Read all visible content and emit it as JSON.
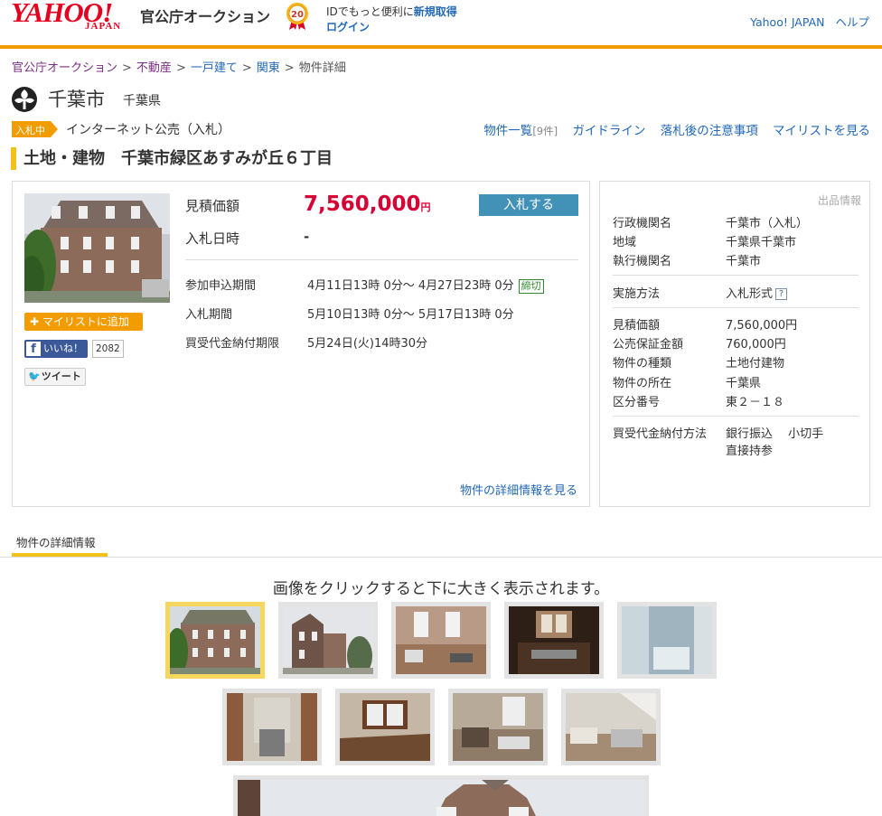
{
  "header": {
    "logo_main": "YAHOO!",
    "logo_sub": "JAPAN",
    "service_name": "官公庁オークション",
    "anniversary": "20",
    "id_message": "IDでもっと便利に",
    "register_link": "新規取得",
    "login_link": "ログイン",
    "yahoo_japan_link": "Yahoo! JAPAN",
    "help_link": "ヘルプ"
  },
  "breadcrumb": {
    "items": [
      "官公庁オークション",
      "不動産",
      "一戸建て",
      "関東",
      "物件詳細"
    ],
    "separator": ">"
  },
  "seller": {
    "city": "千葉市",
    "prefecture": "千葉県",
    "status_tag": "入札中",
    "auction_type": "インターネット公売（入札）"
  },
  "nav": {
    "list_link": "物件一覧",
    "list_count": "[9件]",
    "guideline_link": "ガイドライン",
    "notes_link": "落札後の注意事項",
    "mylist_link": "マイリストを見る"
  },
  "property_title": "土地・建物　千葉市緑区あすみが丘６丁目",
  "main_panel": {
    "add_mylist": "マイリストに追加",
    "fb_like": "いいね！",
    "fb_count": "2082",
    "tweet": "ツイート",
    "price_label": "見積価額",
    "price_value": "7,560,000",
    "price_unit": "円",
    "bid_button": "入札する",
    "bid_date_label": "入札日時",
    "bid_date_value": "-",
    "entry_label": "参加申込期間",
    "entry_value": "4月11日13時 0分～ 4月27日23時 0分",
    "entry_closed": "締切",
    "bid_period_label": "入札期間",
    "bid_period_value": "5月10日13時 0分～ 5月17日13時 0分",
    "payment_label": "買受代金納付期限",
    "payment_value": "5月24日(火)14時30分",
    "detail_link": "物件の詳細情報を見る"
  },
  "info_panel": {
    "caption": "出品情報",
    "rows": [
      {
        "label": "行政機関名",
        "value": "千葉市（入札）"
      },
      {
        "label": "地域",
        "value": "千葉県千葉市"
      },
      {
        "label": "執行機関名",
        "value": "千葉市"
      },
      {
        "label": "実施方法",
        "value": "入札形式"
      },
      {
        "label": "見積価額",
        "value": "7,560,000円"
      },
      {
        "label": "公売保証金額",
        "value": "760,000円"
      },
      {
        "label": "物件の種類",
        "value": "土地付建物"
      },
      {
        "label": "物件の所在",
        "value": "千葉県"
      },
      {
        "label": "区分番号",
        "value": "東２－１８"
      },
      {
        "label": "買受代金納付方法",
        "value": "銀行振込　 小切手"
      }
    ],
    "payment_extra": "直接持参",
    "help_icon": "?"
  },
  "tabs": {
    "active": "物件の詳細情報"
  },
  "gallery": {
    "caption": "画像をクリックすると下に大きく表示されます。",
    "selected_index": 0,
    "thumb_count": 9
  },
  "colors": {
    "accent_orange": "#f29c00",
    "price_red": "#d70035",
    "link_blue": "#2369b5",
    "highlight_yellow": "#f2c21b"
  }
}
